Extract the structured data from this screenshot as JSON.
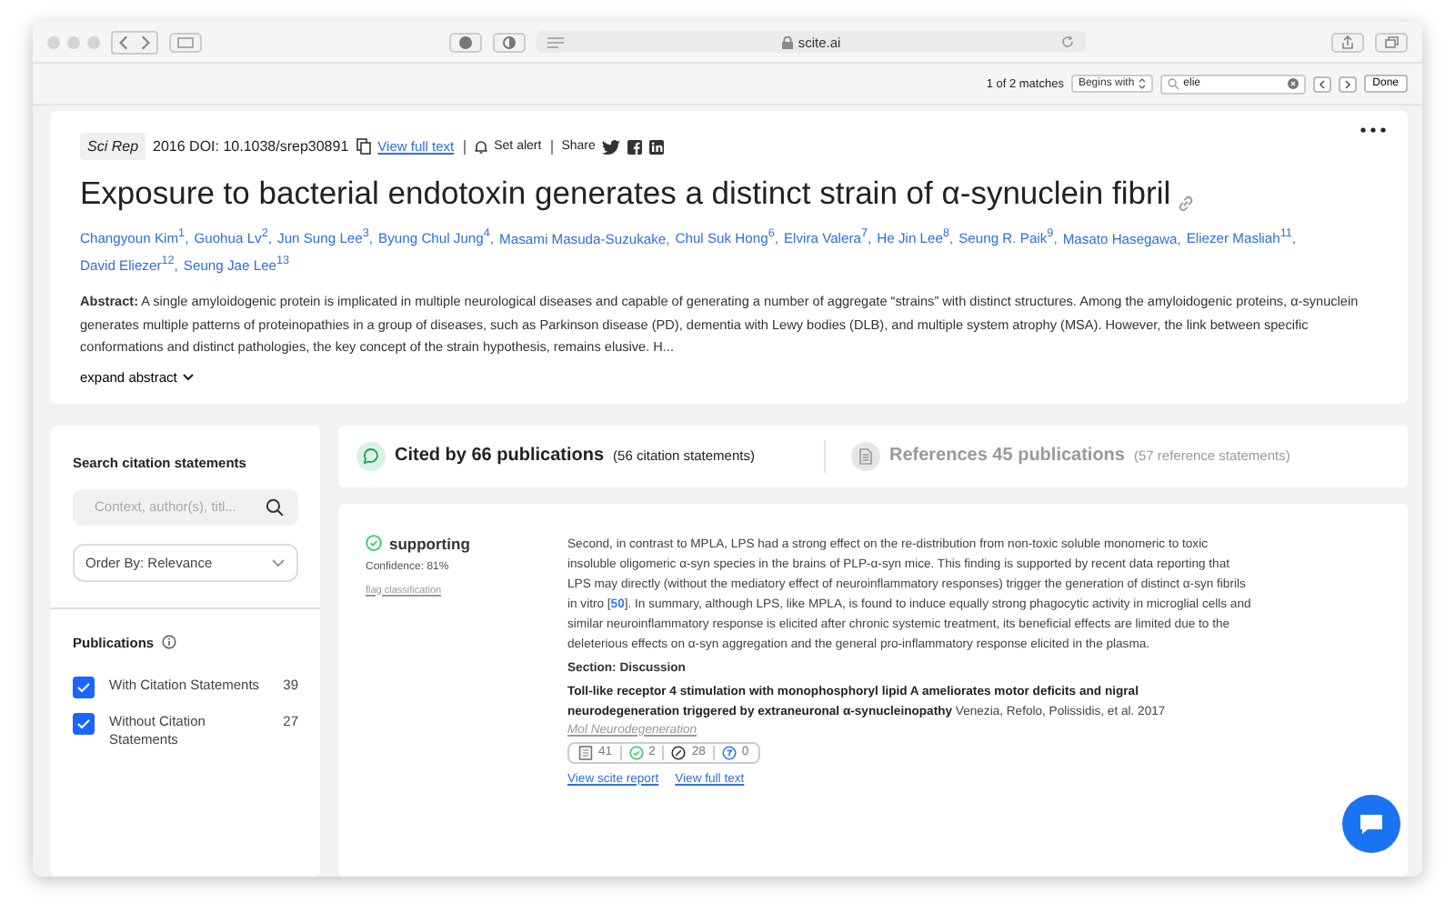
{
  "browser": {
    "url": "scite.ai",
    "find_bar": {
      "matches": "1 of 2 matches",
      "mode": "Begins with",
      "query": "elie",
      "done": "Done"
    }
  },
  "paper": {
    "journal": "Sci Rep",
    "meta": "2016 DOI: 10.1038/srep30891",
    "view_full_text": "View full text",
    "set_alert": "Set alert",
    "share": "Share",
    "title": "Exposure to bacterial endotoxin generates a distinct strain of α-synuclein fibril",
    "authors": [
      "Changyoun Kim$^{1}$,",
      "Guohua Lv$^{2}$,",
      "Jun Sung Lee$^{3}$,",
      "Byung Chul Jung$^{4}$,",
      "Masami Masuda-Suzukake,",
      "Chul Suk Hong$^{6}$,",
      "Elvira Valera$^{7}$,",
      "He Jin Lee$^{8}$,",
      "Seung R. Paik$^{9}$,",
      "Masato Hasegawa,",
      "Eliezer Masliah$^{11}$,",
      "David Eliezer$^{12}$,",
      "Seung Jae Lee$^{13}$"
    ],
    "abstract": "**Abstract:** A single amyloidogenic protein is implicated in multiple neurological diseases and capable of generating a number of aggregate “strains” with distinct structures. Among the amyloidogenic proteins, α-synuclein generates multiple patterns of proteinopathies in a group of diseases, such as Parkinson disease (PD), dementia with Lewy bodies (DLB), and multiple system atrophy (MSA). However, the link between specific conformations and distinct pathologies, the key concept of the strain hypothesis, remains elusive. H...",
    "expand": "expand abstract"
  },
  "sidebar": {
    "search_title": "Search citation statements",
    "search_placeholder": "Context, author(s), titl...",
    "order_by": "Order By: Relevance",
    "publications_title": "Publications",
    "filters": [
      {
        "label": "With Citation Statements",
        "count": "39",
        "checked": true
      },
      {
        "label": "Without Citation Statements",
        "count": "27",
        "checked": true
      }
    ]
  },
  "tabs": [
    {
      "kind": "cited",
      "label": "Cited by 66 publications",
      "sub": "(56 citation statements)",
      "selected": true
    },
    {
      "kind": "references",
      "label": "References 45 publications",
      "sub": "(57 reference statements)",
      "selected": false
    }
  ],
  "citation": {
    "type": "supporting",
    "confidence": "Confidence: 81%",
    "flag": "flag classification",
    "text_before": "Second, in contrast to MPLA, LPS had a strong effect on the re-distribution from non-toxic soluble monomeric to toxic insoluble oligomeric α-syn species in the brains of PLP-α-syn mice. This finding is supported by recent data reporting that LPS may directly (without the mediatory effect of neuroinflammatory responses) trigger the generation of distinct α-syn fibrils in vitro [",
    "ref": "50",
    "text_after": "]. In summary, although LPS, like MPLA, is found to induce equally strong phagocytic activity in microglial cells and similar neuroinflammatory response is elicited after chronic systemic treatment, its beneficial effects are limited due to the deleterious effects on α-syn aggregation and the general pro-inflammatory response elicited in the plasma.",
    "section": "Section: Discussion",
    "reference": "**Toll-like receptor 4 stimulation with monophosphoryl lipid A ameliorates motor deficits and nigral neurodegeneration triggered by extraneuronal α-synucleinopathy** Venezia, Refolo, Polissidis, et al. 2017",
    "journal": "Mol Neurodegeneration",
    "counts": [
      {
        "kind": "total",
        "value": "41"
      },
      {
        "kind": "supporting",
        "value": "2"
      },
      {
        "kind": "mentioning",
        "value": "28"
      },
      {
        "kind": "contrasting",
        "value": "0"
      }
    ],
    "links": [
      "View scite report",
      "View full text"
    ]
  }
}
